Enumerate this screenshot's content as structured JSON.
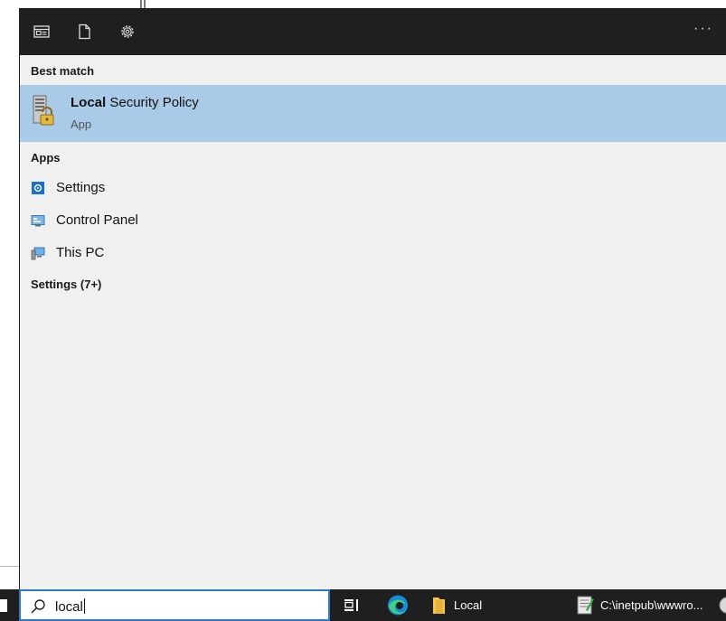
{
  "toolbar": {
    "icons": [
      "news-icon",
      "document-icon",
      "gear-icon"
    ],
    "more_label": "···"
  },
  "best_match": {
    "header": "Best match",
    "title_bold": "Local",
    "title_rest": " Security Policy",
    "subtitle": "App"
  },
  "apps": {
    "header": "Apps",
    "items": [
      {
        "label": "Settings",
        "icon": "settings-app-icon"
      },
      {
        "label": "Control Panel",
        "icon": "control-panel-icon"
      },
      {
        "label": "This PC",
        "icon": "this-pc-icon"
      }
    ]
  },
  "settings_section": {
    "header": "Settings (7+)"
  },
  "search": {
    "value": "local"
  },
  "taskbar": {
    "folder_label": "Local",
    "notepad_label": "C:\\inetpub\\wwwro..."
  },
  "colors": {
    "accent": "#2d7ad6",
    "selection": "#a9cbe8",
    "panel": "#f0f0f0",
    "dark": "#1f1f1f"
  }
}
